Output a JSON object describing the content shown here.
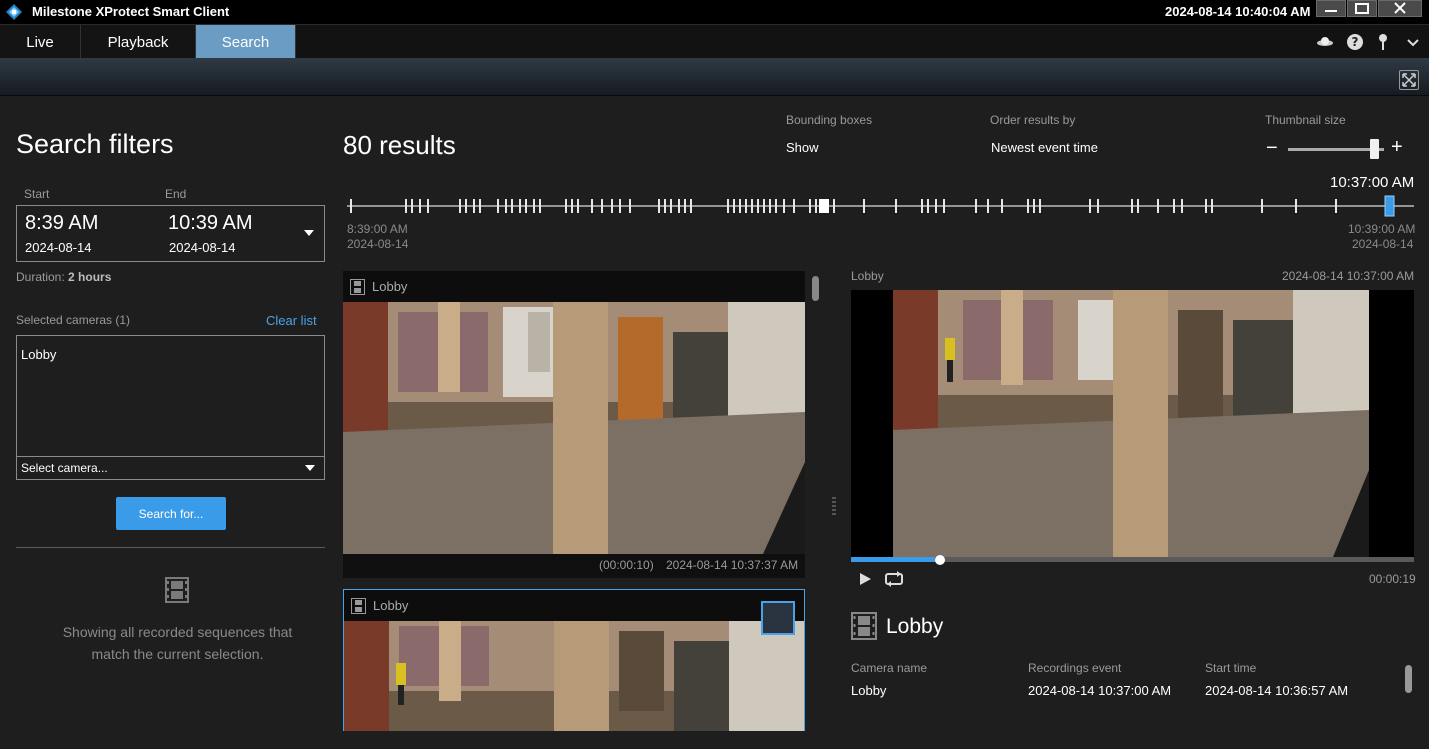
{
  "app": {
    "title": "Milestone XProtect Smart Client",
    "clock": "2024-08-14 10:40:04 AM"
  },
  "tabs": [
    {
      "label": "Live"
    },
    {
      "label": "Playback"
    },
    {
      "label": "Search"
    }
  ],
  "filters": {
    "title": "Search filters",
    "start_label": "Start",
    "end_label": "End",
    "start_time": "8:39 AM",
    "start_date": "2024-08-14",
    "end_time": "10:39 AM",
    "end_date": "2024-08-14",
    "duration_label": "Duration:",
    "duration_value": "2 hours",
    "selected_cameras_label": "Selected cameras (1)",
    "clear_list": "Clear list",
    "cameras": [
      "Lobby"
    ],
    "select_camera_placeholder": "Select camera...",
    "search_button": "Search for...",
    "empty_message": "Showing all recorded sequences that match the current selection."
  },
  "results": {
    "count_label": "80 results",
    "bounding_boxes_label": "Bounding boxes",
    "bounding_boxes_value": "Show",
    "order_label": "Order results by",
    "order_value": "Newest event time",
    "thumbnail_label": "Thumbnail size",
    "thumbnail_level": 0.9,
    "timeline": {
      "current": "10:37:00 AM",
      "start_time": "8:39:00 AM",
      "start_date": "2024-08-14",
      "end_time": "10:39:00 AM",
      "end_date": "2024-08-14"
    },
    "items": [
      {
        "camera": "Lobby",
        "duration": "(00:00:10)",
        "timestamp": "2024-08-14 10:37:37 AM"
      },
      {
        "camera": "Lobby"
      }
    ]
  },
  "preview": {
    "camera": "Lobby",
    "timestamp": "2024-08-14 10:37:00 AM",
    "progress": 0.15,
    "duration": "00:00:19",
    "title": "Lobby",
    "camera_name_label": "Camera name",
    "camera_name": "Lobby",
    "event_label": "Recordings event",
    "event_value": "2024-08-14 10:37:00 AM",
    "start_label": "Start time",
    "start_value": "2024-08-14 10:36:57 AM"
  },
  "colors": {
    "accent": "#3a9be8",
    "active_tab": "#6b9cc4",
    "background": "#1e1e1e"
  }
}
